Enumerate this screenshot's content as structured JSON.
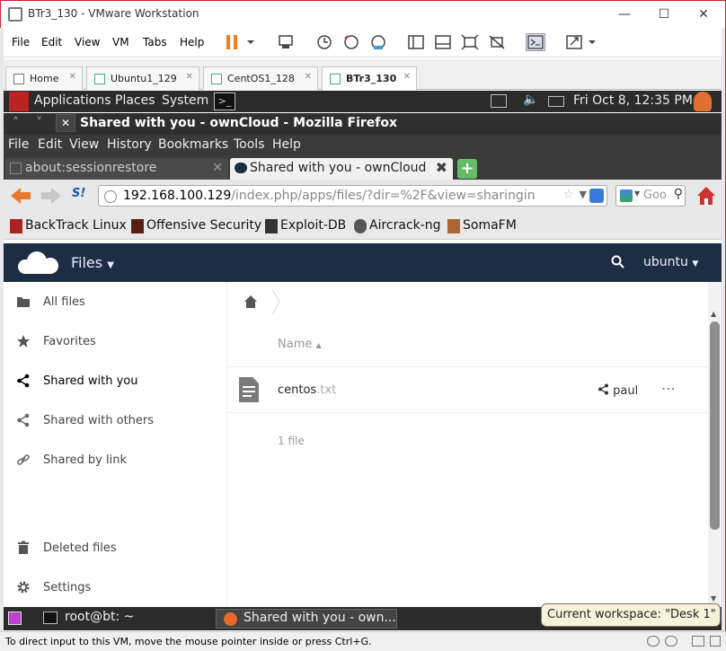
{
  "vmware": {
    "title": "BTr3_130 - VMware Workstation",
    "menu": [
      "File",
      "Edit",
      "View",
      "VM",
      "Tabs",
      "Help"
    ],
    "tabs": [
      {
        "label": "Home"
      },
      {
        "label": "Ubuntu1_129"
      },
      {
        "label": "CentOS1_128"
      },
      {
        "label": "BTr3_130"
      }
    ],
    "status_text": "To direct input to this VM, move the mouse pointer inside or press Ctrl+G."
  },
  "gnome": {
    "menus": [
      "Applications",
      "Places",
      "System"
    ],
    "clock": "Fri Oct  8, 12:35 PM",
    "taskbar": {
      "terminal": "root@bt: ~",
      "firefox": "Shared with you - own...",
      "workspace_tooltip": "Current workspace: \"Desk 1\""
    }
  },
  "firefox": {
    "window_title": "Shared with you - ownCloud - Mozilla Firefox",
    "menu": [
      "File",
      "Edit",
      "View",
      "History",
      "Bookmarks",
      "Tools",
      "Help"
    ],
    "tabs": [
      {
        "label": "about:sessionrestore"
      },
      {
        "label": "Shared with you - ownCloud"
      }
    ],
    "url_host": "192.168.100.129",
    "url_rest": "/index.php/apps/files/?dir=%2F&view=sharingin",
    "search_placeholder": "Goo",
    "bookmarks": [
      "BackTrack Linux",
      "Offensive Security",
      "Exploit-DB",
      "Aircrack-ng",
      "SomaFM"
    ]
  },
  "owncloud": {
    "app_name": "Files",
    "user": "ubuntu",
    "sidebar": [
      {
        "label": "All files"
      },
      {
        "label": "Favorites"
      },
      {
        "label": "Shared with you"
      },
      {
        "label": "Shared with others"
      },
      {
        "label": "Shared by link"
      }
    ],
    "deleted_files": "Deleted files",
    "settings": "Settings",
    "column_name": "Name",
    "file": {
      "name": "centos",
      "ext": ".txt",
      "shared_by": "paul"
    },
    "summary": "1 file"
  }
}
